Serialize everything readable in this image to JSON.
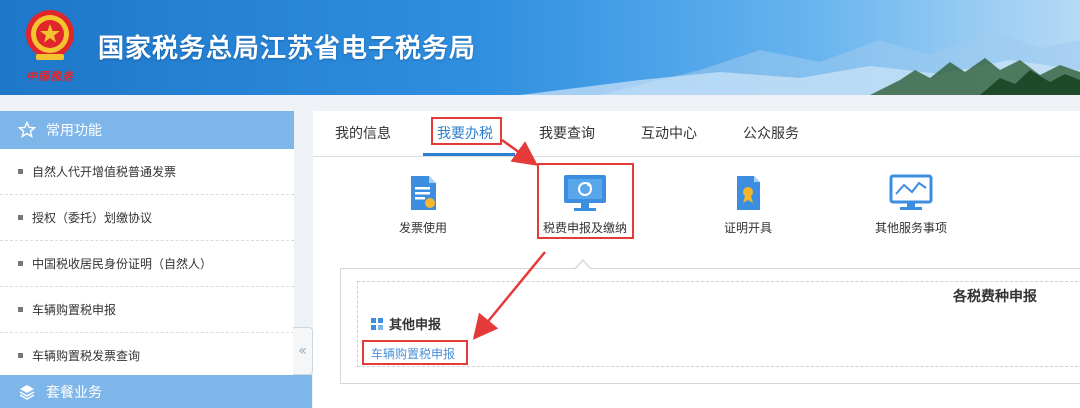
{
  "header": {
    "title": "国家税务总局江苏省电子税务局",
    "emblem_subtitle": "中国税务",
    "colors": {
      "brand_blue": "#1e77c9",
      "emblem_red": "#e0262a"
    }
  },
  "sidebar": {
    "section_title": "常用功能",
    "section_icon": "star-outline-icon",
    "items": [
      {
        "label": "自然人代开增值税普通发票"
      },
      {
        "label": "授权（委托）划缴协议"
      },
      {
        "label": "中国税收居民身份证明（自然人）"
      },
      {
        "label": "车辆购置税申报"
      },
      {
        "label": "车辆购置税发票查询"
      }
    ],
    "footer_title": "套餐业务",
    "footer_icon": "layers-icon",
    "collapse_label": "«",
    "header_color": "#7eb6e9"
  },
  "main": {
    "tabs": [
      {
        "label": "我的信息",
        "active": false
      },
      {
        "label": "我要办税",
        "active": true
      },
      {
        "label": "我要查询",
        "active": false
      },
      {
        "label": "互动中心",
        "active": false
      },
      {
        "label": "公众服务",
        "active": false
      }
    ],
    "accent_color": "#2b7fd0",
    "services": [
      {
        "label": "发票使用",
        "icon": "invoice-document-icon"
      },
      {
        "label": "税费申报及缴纳",
        "icon": "monitor-refresh-icon"
      },
      {
        "label": "证明开具",
        "icon": "certificate-file-icon"
      },
      {
        "label": "其他服务事项",
        "icon": "monitor-chart-icon"
      }
    ],
    "panel": {
      "title": "各税费种申报",
      "group_title": "其他申报",
      "group_icon": "grid-icon",
      "links": [
        {
          "label": "车辆购置税申报"
        }
      ]
    }
  },
  "annotation_color": "#e53a3a"
}
